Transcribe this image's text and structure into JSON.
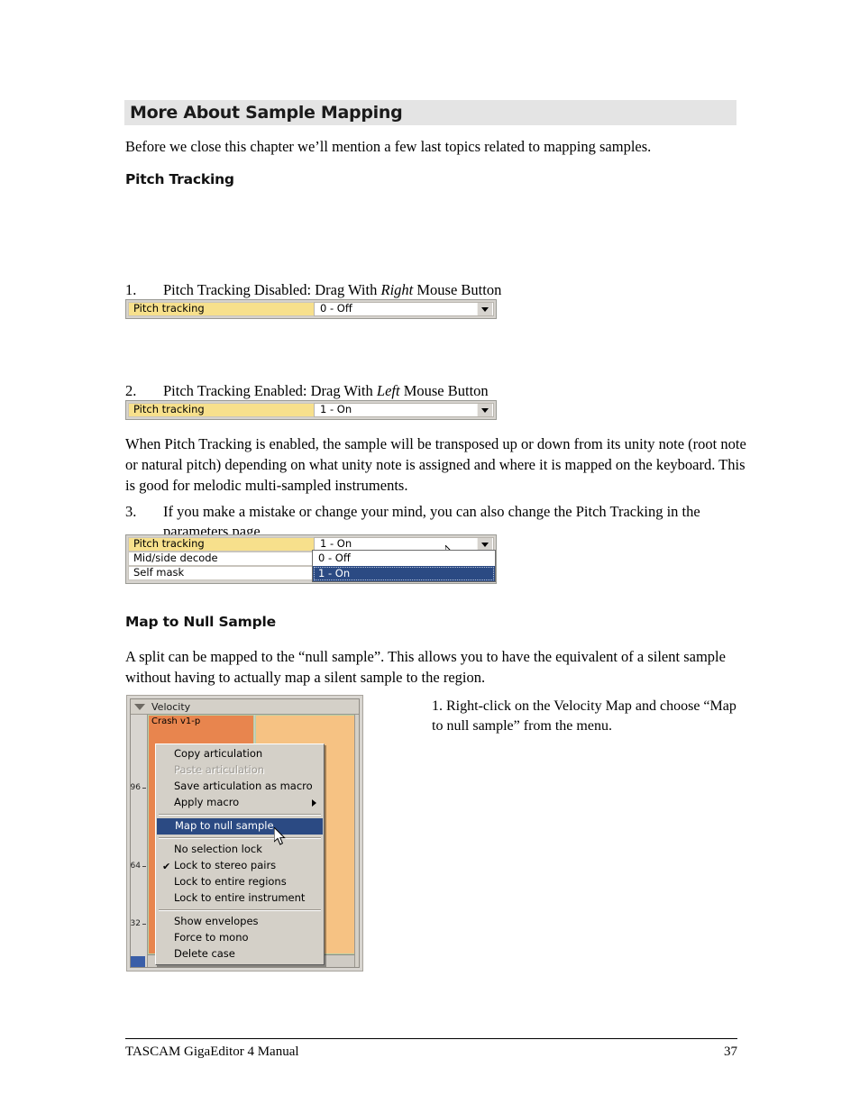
{
  "document": {
    "section_heading": "More About Sample Mapping",
    "intro_paragraph": "Before we close this chapter we’ll mention a few last topics related to mapping samples."
  },
  "pitch_tracking": {
    "heading": "Pitch Tracking",
    "items": [
      {
        "number": "1.",
        "text_before": "Pitch Tracking Disabled: Drag With ",
        "emphasis": "Right",
        "text_after": " Mouse Button"
      },
      {
        "number": "2.",
        "text_before": "Pitch Tracking Enabled: Drag With ",
        "emphasis": "Left",
        "text_after": " Mouse Button"
      },
      {
        "number": "3.",
        "text_before": "If you make a mistake or change your mind, you can also change the Pitch Tracking in the parameters page.",
        "emphasis": "",
        "text_after": ""
      }
    ],
    "description": "When Pitch Tracking is enabled, the sample will be transposed up or down from its unity note (root note or natural pitch) depending on what unity note is assigned and where it is mapped on the keyboard.  This is good for melodic multi-sampled instruments."
  },
  "widget_1": {
    "label": "Pitch tracking",
    "value": "0 - Off"
  },
  "widget_2": {
    "label": "Pitch tracking",
    "value": "1 - On"
  },
  "widget_3": {
    "rows": [
      {
        "label": "Pitch tracking",
        "value": "1 - On"
      },
      {
        "label": "Mid/side decode",
        "value": ""
      },
      {
        "label": "Self mask",
        "value": ""
      }
    ],
    "dropdown_options": [
      {
        "label": "0 - Off",
        "selected": false
      },
      {
        "label": "1 - On",
        "selected": true
      }
    ]
  },
  "map_to_null": {
    "heading": "Map to Null Sample",
    "description": "A split can be mapped to the “null sample”.  This allows you to have the equivalent of a silent sample without having to actually map a silent sample to the region.",
    "caption": "1. Right-click on the Velocity Map and choose “Map to null sample” from the menu."
  },
  "velocity_panel": {
    "title": "Velocity",
    "region_label": "Crash v1-p",
    "axis_ticks": [
      "96",
      "64",
      "32"
    ]
  },
  "context_menu": {
    "items": [
      {
        "label": "Copy articulation",
        "state": "normal",
        "submenu": false,
        "checked": false
      },
      {
        "label": "Paste articulation",
        "state": "disabled",
        "submenu": false,
        "checked": false
      },
      {
        "label": "Save articulation as macro",
        "state": "normal",
        "submenu": false,
        "checked": false
      },
      {
        "label": "Apply macro",
        "state": "normal",
        "submenu": true,
        "checked": false
      },
      {
        "label": "Map to null sample",
        "state": "highlight",
        "submenu": false,
        "checked": false
      },
      {
        "label": "No selection lock",
        "state": "normal",
        "submenu": false,
        "checked": false
      },
      {
        "label": "Lock to stereo pairs",
        "state": "normal",
        "submenu": false,
        "checked": true
      },
      {
        "label": "Lock to entire regions",
        "state": "normal",
        "submenu": false,
        "checked": false
      },
      {
        "label": "Lock to entire instrument",
        "state": "normal",
        "submenu": false,
        "checked": false
      },
      {
        "label": "Show envelopes",
        "state": "normal",
        "submenu": false,
        "checked": false
      },
      {
        "label": "Force to mono",
        "state": "normal",
        "submenu": false,
        "checked": false
      },
      {
        "label": "Delete case",
        "state": "normal",
        "submenu": false,
        "checked": false
      }
    ],
    "check_glyph": "✔",
    "separator_after": [
      3,
      4,
      8
    ]
  },
  "footer": {
    "left": "TASCAM GigaEditor 4 Manual",
    "page_number": "37"
  },
  "colors": {
    "heading_bar": "#e4e4e4",
    "param_label_yellow": "#f7e08c",
    "menu_highlight": "#2b4a83",
    "region_dark_orange": "#e8854e",
    "region_light_orange": "#f6c283",
    "menu_face": "#d4d0c8"
  }
}
